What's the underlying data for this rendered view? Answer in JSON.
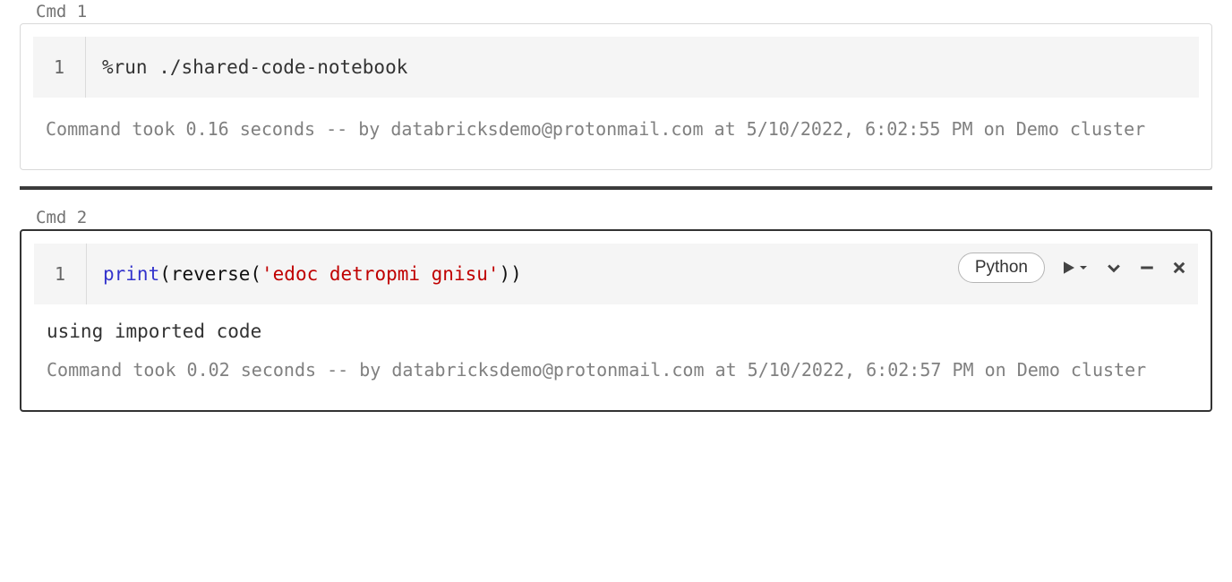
{
  "cells": [
    {
      "label": "Cmd 1",
      "line_no": "1",
      "code_plain": "%run ./shared-code-notebook",
      "output": "",
      "status": "Command took 0.16 seconds -- by databricksdemo@protonmail.com at 5/10/2022, 6:02:55 PM on Demo cluster",
      "active": false
    },
    {
      "label": "Cmd 2",
      "line_no": "1",
      "code_tokens": {
        "builtin": "print",
        "open": "(reverse(",
        "string": "'edoc detropmi gnisu'",
        "close": "))"
      },
      "output": "using imported code",
      "status": "Command took 0.02 seconds -- by databricksdemo@protonmail.com at 5/10/2022, 6:02:57 PM on Demo cluster",
      "lang_pill": "Python",
      "active": true
    }
  ]
}
